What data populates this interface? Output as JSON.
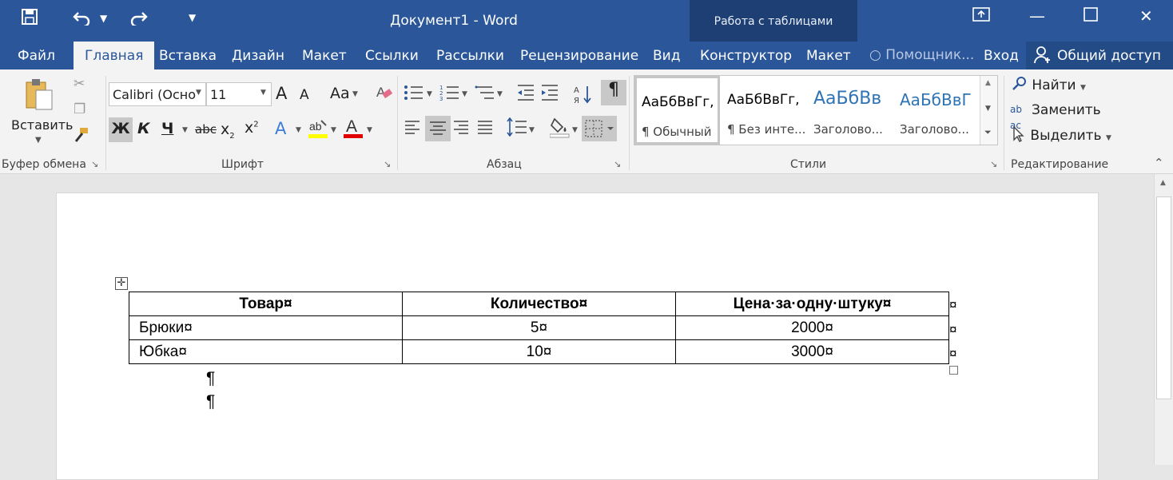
{
  "window": {
    "title": "Документ1 - Word",
    "context_title": "Работа с таблицами"
  },
  "qat": {
    "save_icon": "save-icon",
    "undo_icon": "undo-icon",
    "redo_icon": "redo-icon",
    "customize_icon": "customize-icon"
  },
  "tabs": {
    "file": "Файл",
    "home": "Главная",
    "insert": "Вставка",
    "design": "Дизайн",
    "layout": "Макет",
    "references": "Ссылки",
    "mailings": "Рассылки",
    "review": "Рецензирование",
    "view": "Вид",
    "table_design": "Конструктор",
    "table_layout": "Макет",
    "tell_me": "Помощник...",
    "signin": "Вход",
    "share": "Общий доступ"
  },
  "clipboard": {
    "paste": "Вставить",
    "label": "Буфер обмена"
  },
  "font": {
    "name": "Calibri (Осно",
    "size": "11",
    "label": "Шрифт",
    "bold": "Ж",
    "italic": "К",
    "underline": "Ч",
    "strike": "abc",
    "grow": "A",
    "shrink": "A",
    "case": "Aa"
  },
  "paragraph": {
    "label": "Абзац",
    "pilcrow": "¶"
  },
  "styles": {
    "label": "Стили",
    "items": [
      {
        "sample": "АаБбВвГг,",
        "name": "¶ Обычный",
        "color": "#000000"
      },
      {
        "sample": "АаБбВвГг,",
        "name": "¶ Без инте...",
        "color": "#000000"
      },
      {
        "sample": "АаБбВв",
        "name": "Заголово...",
        "color": "#2e74b5"
      },
      {
        "sample": "АаБбВвГ",
        "name": "Заголово...",
        "color": "#2e74b5"
      }
    ]
  },
  "editing": {
    "find": "Найти",
    "replace": "Заменить",
    "select": "Выделить",
    "label": "Редактирование"
  },
  "table": {
    "headers": [
      "Товар¤",
      "Количество¤",
      "Цена·за·одну·штуку¤"
    ],
    "rows": [
      [
        "Брюки¤",
        "5¤",
        "2000¤"
      ],
      [
        "Юбка¤",
        "10¤",
        "3000¤"
      ]
    ],
    "end_mark": "¤"
  },
  "doc": {
    "para1": "¶",
    "para2": "¶"
  },
  "colors": {
    "accent": "#2b579a",
    "context": "#1e3f73"
  }
}
